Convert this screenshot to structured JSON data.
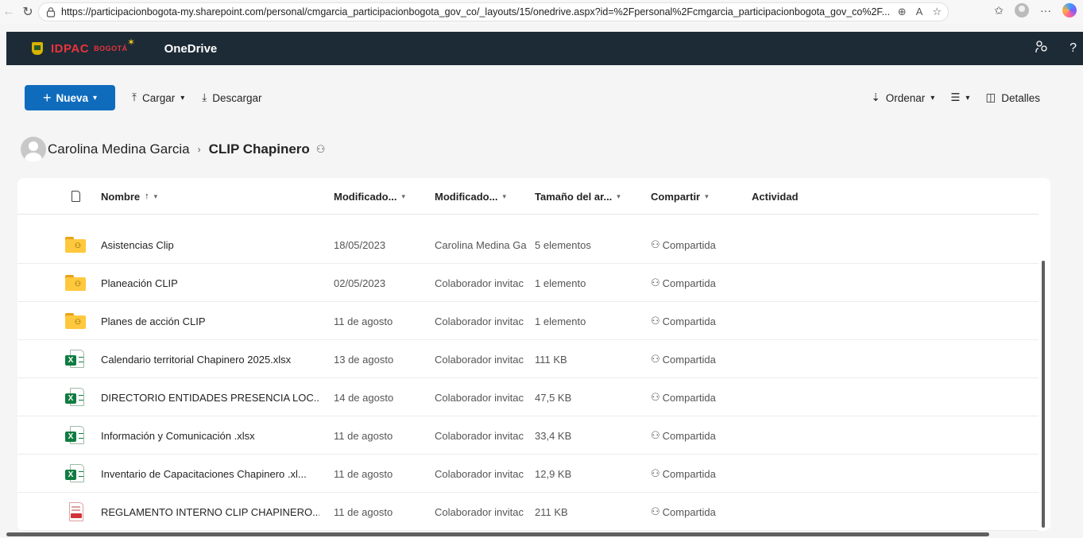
{
  "browser": {
    "url": "https://participacionbogota-my.sharepoint.com/personal/cmgarcia_participacionbogota_gov_co/_layouts/15/onedrive.aspx?id=%2Fpersonal%2Fcmgarcia_participacionbogota_gov_co%2F..."
  },
  "header": {
    "logo_text": "IDPAC",
    "logo_sub": "BOGOTÁ",
    "app_title": "OneDrive",
    "help_label": "?"
  },
  "toolbar": {
    "new_label": "Nueva",
    "upload_label": "Cargar",
    "download_label": "Descargar",
    "sort_label": "Ordenar",
    "details_label": "Detalles"
  },
  "breadcrumb": {
    "owner": "Carolina Medina Garcia",
    "current": "CLIP Chapinero"
  },
  "columns": {
    "name": "Nombre",
    "modified": "Modificado...",
    "modified_by": "Modificado...",
    "size": "Tamaño del ar...",
    "sharing": "Compartir",
    "activity": "Actividad"
  },
  "rows": [
    {
      "type": "folder",
      "name": "Asistencias Clip",
      "modified": "18/05/2023",
      "modified_by": "Carolina Medina Ga",
      "size": "5 elementos",
      "sharing": "Compartida"
    },
    {
      "type": "folder",
      "name": "Planeación CLIP",
      "modified": "02/05/2023",
      "modified_by": "Colaborador invitac",
      "size": "1 elemento",
      "sharing": "Compartida"
    },
    {
      "type": "folder",
      "name": "Planes de acción CLIP",
      "modified": "11 de agosto",
      "modified_by": "Colaborador invitac",
      "size": "1 elemento",
      "sharing": "Compartida"
    },
    {
      "type": "xlsx",
      "name": "Calendario territorial Chapinero 2025.xlsx",
      "modified": "13 de agosto",
      "modified_by": "Colaborador invitac",
      "size": "111 KB",
      "sharing": "Compartida"
    },
    {
      "type": "xlsx",
      "name": "DIRECTORIO ENTIDADES PRESENCIA LOC...",
      "modified": "14 de agosto",
      "modified_by": "Colaborador invitac",
      "size": "47,5 KB",
      "sharing": "Compartida"
    },
    {
      "type": "xlsx",
      "name": "Información y Comunicación .xlsx",
      "modified": "11 de agosto",
      "modified_by": "Colaborador invitac",
      "size": "33,4 KB",
      "sharing": "Compartida"
    },
    {
      "type": "xlsx",
      "name": "Inventario de Capacitaciones Chapinero .xl...",
      "modified": "11 de agosto",
      "modified_by": "Colaborador invitac",
      "size": "12,9 KB",
      "sharing": "Compartida"
    },
    {
      "type": "pdf",
      "name": "REGLAMENTO INTERNO CLIP CHAPINERO...",
      "modified": "11 de agosto",
      "modified_by": "Colaborador invitac",
      "size": "211 KB",
      "sharing": "Compartida"
    }
  ],
  "colors": {
    "header_bg": "#1d2b36",
    "accent": "#0f6cbd",
    "folder": "#ffc83d",
    "excel": "#107c41",
    "pdf": "#d13438"
  }
}
